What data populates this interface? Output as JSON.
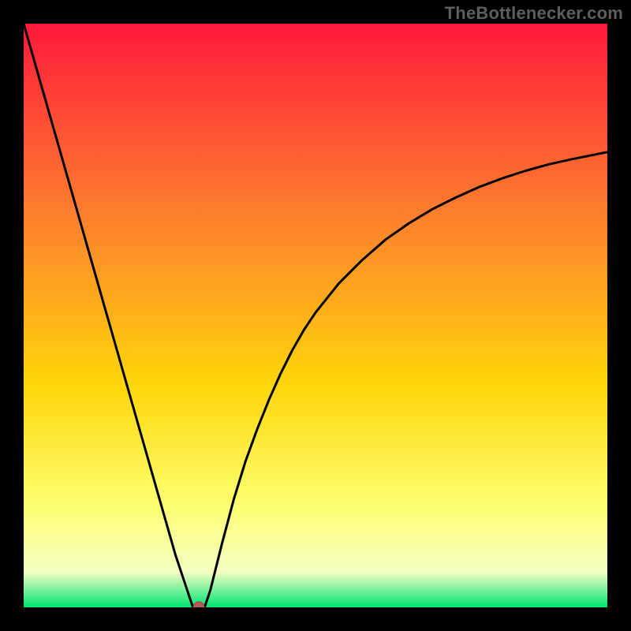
{
  "watermark": "TheBottlenecker.com",
  "colors": {
    "frame": "#000000",
    "watermark_text": "#5e5e5e",
    "gradient_top": "#fe1a3a",
    "gradient_mid1": "#fd7d2e",
    "gradient_mid2": "#fed60a",
    "gradient_mid3": "#fdfe6d",
    "gradient_low": "#f3fec2",
    "gradient_bottom": "#00e472",
    "curve": "#000000",
    "marker_fill": "#b85a55",
    "marker_stroke": "#9a3f3a"
  },
  "chart_data": {
    "type": "line",
    "title": "",
    "xlabel": "",
    "ylabel": "",
    "xlim": [
      0,
      100
    ],
    "ylim": [
      0,
      100
    ],
    "grid": false,
    "legend": false,
    "x": [
      0,
      2,
      4,
      6,
      8,
      10,
      12,
      14,
      16,
      18,
      20,
      22,
      24,
      26,
      28,
      29,
      30,
      31,
      32,
      34,
      36,
      38,
      40,
      42,
      44,
      46,
      48,
      50,
      54,
      58,
      62,
      66,
      70,
      74,
      78,
      82,
      86,
      90,
      94,
      98,
      100
    ],
    "values": [
      100,
      93,
      86,
      79,
      72,
      65,
      58,
      51,
      44,
      37,
      30,
      23,
      16,
      9,
      3,
      0,
      0,
      0,
      3,
      11,
      18.5,
      25,
      30.5,
      35.5,
      40,
      44,
      47.5,
      50.5,
      55.5,
      59.5,
      63,
      65.8,
      68.2,
      70.2,
      72,
      73.5,
      74.8,
      75.9,
      76.8,
      77.6,
      78
    ],
    "marker": {
      "x": 30,
      "y": 0
    },
    "notch": {
      "x_start": 28,
      "x_end": 31,
      "y": 0
    }
  }
}
